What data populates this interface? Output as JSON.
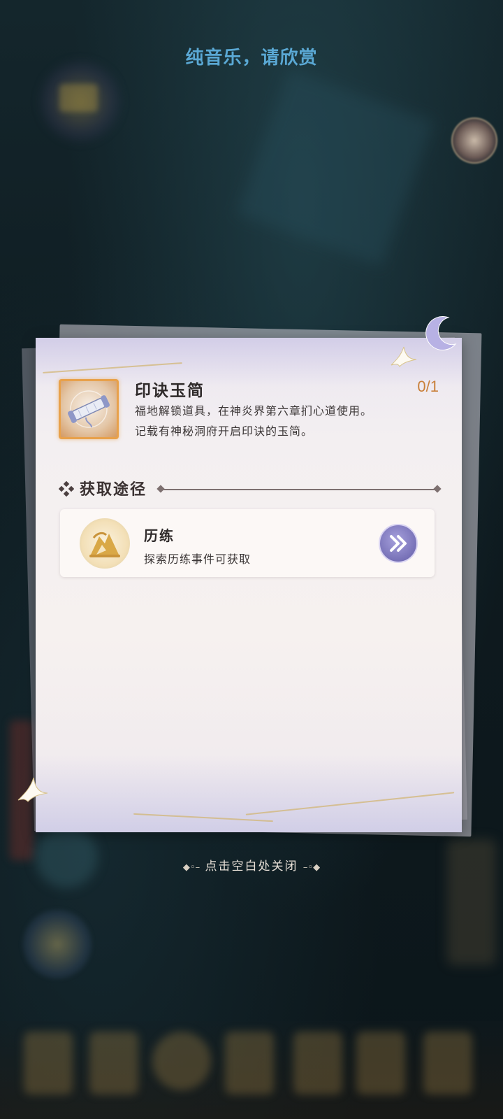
{
  "header": {
    "notice": "纯音乐，请欣赏"
  },
  "item": {
    "name": "印诀玉简",
    "count": "0/1",
    "description_lines": [
      "福地解锁道具，在神炎界第六章扪心道使用。",
      "记载有神秘洞府开启印诀的玉简。"
    ],
    "icon": "jade-scroll-icon"
  },
  "acquire_section": {
    "title": "获取途径",
    "sources": [
      {
        "title": "历练",
        "description": "探索历练事件可获取",
        "icon": "mountain-training-icon",
        "action_icon": "double-chevron-right-icon"
      }
    ]
  },
  "footer": {
    "close_hint": "点击空白处关闭"
  },
  "colors": {
    "notice_text": "#5aa8d4",
    "count_text": "#c9803a",
    "icon_frame": "#e8a14b",
    "go_button": "#7771b7"
  }
}
